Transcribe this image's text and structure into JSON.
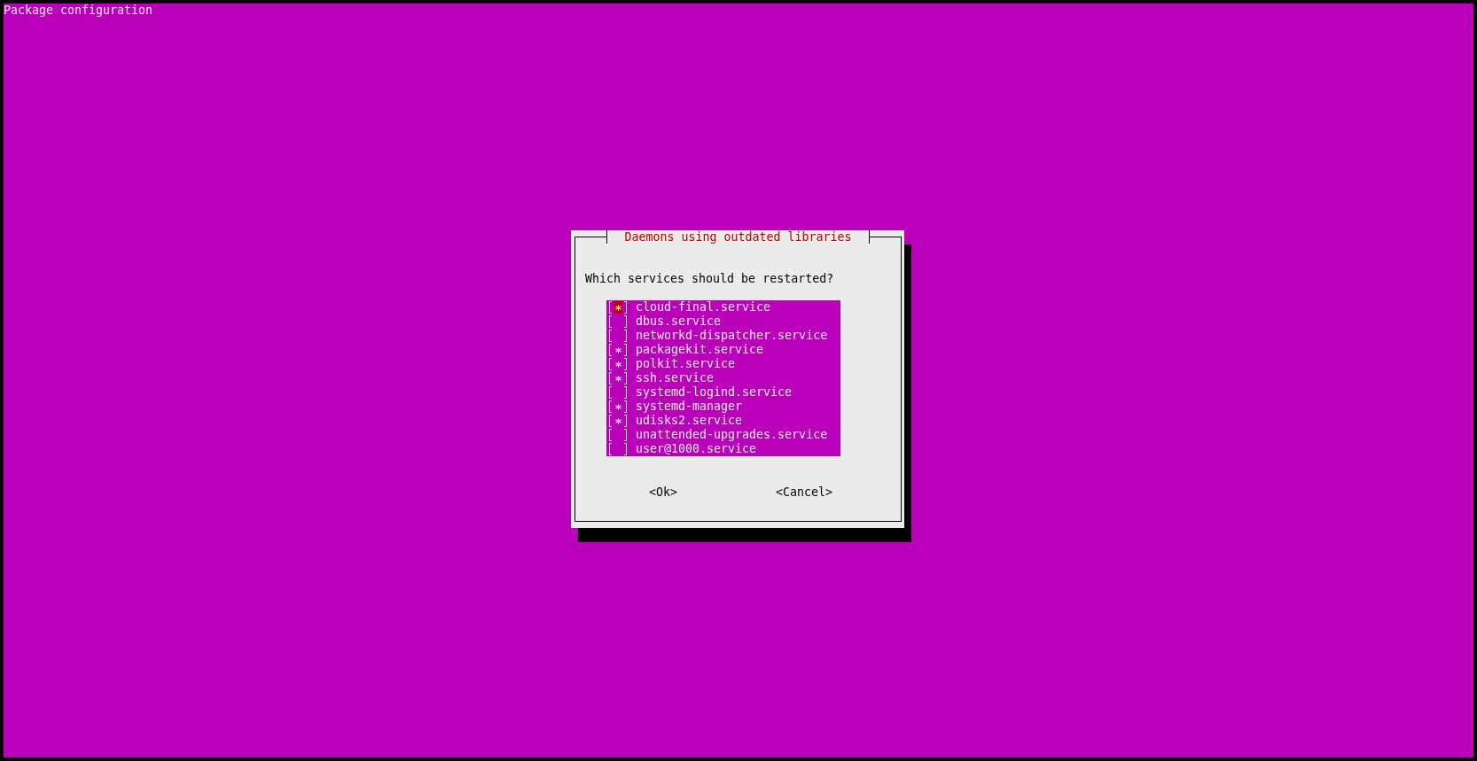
{
  "window": {
    "title": "Package configuration"
  },
  "dialog": {
    "title": "Daemons using outdated libraries",
    "prompt": "Which services should be restarted?",
    "items": [
      {
        "label": "cloud-final.service",
        "checked": true,
        "focused": true
      },
      {
        "label": "dbus.service",
        "checked": false,
        "focused": false
      },
      {
        "label": "networkd-dispatcher.service",
        "checked": false,
        "focused": false
      },
      {
        "label": "packagekit.service",
        "checked": true,
        "focused": false
      },
      {
        "label": "polkit.service",
        "checked": true,
        "focused": false
      },
      {
        "label": "ssh.service",
        "checked": true,
        "focused": false
      },
      {
        "label": "systemd-logind.service",
        "checked": false,
        "focused": false
      },
      {
        "label": "systemd-manager",
        "checked": true,
        "focused": false
      },
      {
        "label": "udisks2.service",
        "checked": true,
        "focused": false
      },
      {
        "label": "unattended-upgrades.service",
        "checked": false,
        "focused": false
      },
      {
        "label": "user@1000.service",
        "checked": false,
        "focused": false
      }
    ],
    "buttons": [
      "<Ok>",
      "<Cancel>"
    ]
  }
}
